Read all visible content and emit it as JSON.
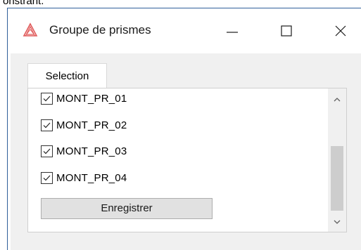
{
  "background_fragment": "onstrant.",
  "window": {
    "title": "Groupe de prismes",
    "icon": "triangle-logo-icon",
    "controls": [
      "minimize-icon",
      "maximize-icon",
      "close-icon"
    ]
  },
  "tabs": [
    {
      "label": "Selection",
      "active": true
    }
  ],
  "list": {
    "items": [
      {
        "label": "MONT_PR_01",
        "checked": true
      },
      {
        "label": "MONT_PR_02",
        "checked": true
      },
      {
        "label": "MONT_PR_03",
        "checked": true
      },
      {
        "label": "MONT_PR_04",
        "checked": true
      }
    ],
    "save_label": "Enregistrer"
  },
  "colors": {
    "accent": "#e05a5a",
    "window_border": "#2f5f9a"
  }
}
